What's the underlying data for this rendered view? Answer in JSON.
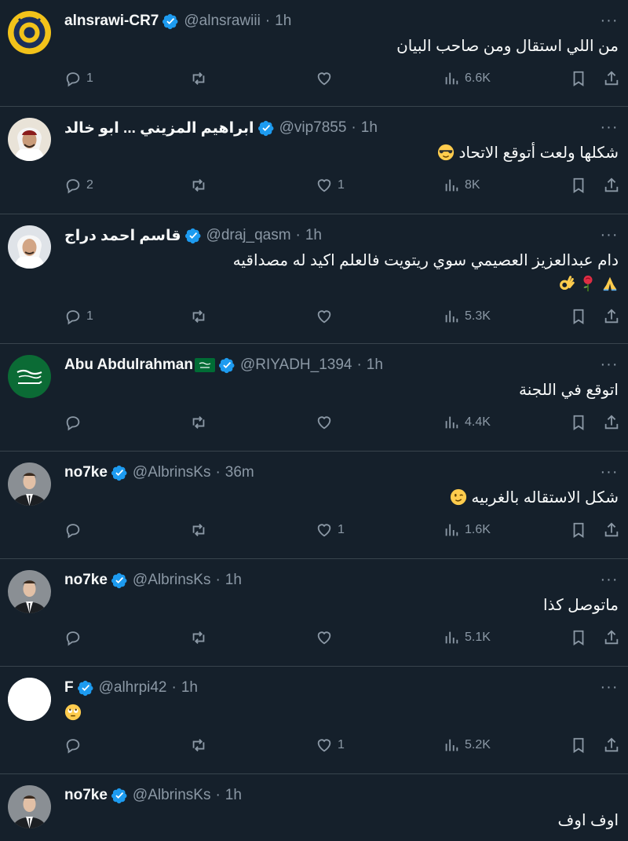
{
  "tweets": [
    {
      "name": "alnsrawi-CR7",
      "handle": "@alnsrawiii",
      "time": "1h",
      "text": "من اللي استقال ومن صاحب البيان",
      "text2": "",
      "replies": "1",
      "retweets": "",
      "likes": "",
      "views": "6.6K",
      "avatar": "club-logo"
    },
    {
      "name": "ابراهيم المزيني ... ابو خالد",
      "handle": "@vip7855",
      "time": "1h",
      "text": "شكلها ولعت أتوقع الاتحاد",
      "text2": "",
      "emoji": "sunglasses-face",
      "replies": "2",
      "retweets": "",
      "likes": "1",
      "views": "8K",
      "avatar": "man-ghutra"
    },
    {
      "name": "قاسم احمد دراج",
      "handle": "@draj_qasm",
      "time": "1h",
      "text": "دام عبدالعزيز العصيمي سوي ريتويت فالعلم اكيد له مصداقيه",
      "text2": "",
      "emoji_line": [
        "folded-hands",
        "rose",
        "ok-hand"
      ],
      "replies": "1",
      "retweets": "",
      "likes": "",
      "views": "5.3K",
      "avatar": "man-ghutra"
    },
    {
      "name": "Abu Abdulrahman",
      "handle": "@RIYADH_1394",
      "time": "1h",
      "text": "اتوقع في اللجنة",
      "text2": "",
      "replies": "",
      "retweets": "",
      "likes": "",
      "views": "4.4K",
      "avatar": "saudi-flag"
    },
    {
      "name": "no7ke",
      "handle": "@AlbrinsKs",
      "time": "36m",
      "text": "شكل الاستقاله بالغربيه",
      "text2": "",
      "emoji": "winking-face",
      "replies": "",
      "retweets": "",
      "likes": "1",
      "views": "1.6K",
      "avatar": "man-suit"
    },
    {
      "name": "no7ke",
      "handle": "@AlbrinsKs",
      "time": "1h",
      "text": "ماتوصل كذا",
      "text2": "",
      "replies": "",
      "retweets": "",
      "likes": "",
      "views": "5.1K",
      "avatar": "man-suit"
    },
    {
      "name": "F",
      "handle": "@alhrpi42",
      "time": "1h",
      "text": "",
      "text2": "",
      "emoji": "rolling-eyes-face",
      "replies": "",
      "retweets": "",
      "likes": "1",
      "views": "5.2K",
      "avatar": "blank-white"
    },
    {
      "name": "no7ke",
      "handle": "@AlbrinsKs",
      "time": "1h",
      "text": "اوف اوف",
      "text2": "",
      "replies": "",
      "retweets": "",
      "likes": "",
      "views": "",
      "avatar": "man-suit"
    }
  ],
  "colors": {
    "background": "#15202b",
    "divider": "#38444d",
    "muted": "#8b98a5",
    "verified": "#1d9bf0",
    "text": "#f7f9f9"
  }
}
